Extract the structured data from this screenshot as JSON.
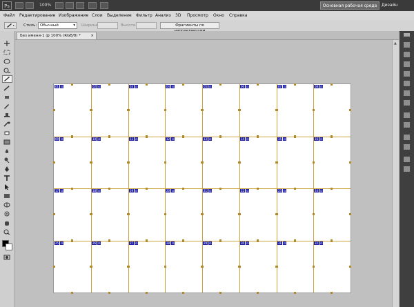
{
  "app": {
    "logo": "Ps",
    "zoom": "100%",
    "workspace": "Основная рабочая среда",
    "design": "Дизайн"
  },
  "menu": [
    "Файл",
    "Редактирование",
    "Изображение",
    "Слои",
    "Выделение",
    "Фильтр",
    "Анализ",
    "3D",
    "Просмотр",
    "Окно",
    "Справка"
  ],
  "options": {
    "style_label": "Стиль:",
    "style_value": "Обычный",
    "width_label": "Ширина:",
    "height_label": "Высота:",
    "guides_button": "Фрагменты по направляющим"
  },
  "document": {
    "tab_title": "Без имени-1 @ 100% (RGB/8) *",
    "close": "×"
  },
  "slices": {
    "rows": 4,
    "cols": 8,
    "ids": [
      "01",
      "02",
      "03",
      "04",
      "05",
      "06",
      "07",
      "08",
      "09",
      "10",
      "11",
      "12",
      "13",
      "14",
      "15",
      "16",
      "17",
      "18",
      "19",
      "20",
      "21",
      "22",
      "23",
      "24",
      "25",
      "26",
      "27",
      "28",
      "29",
      "30",
      "31",
      "32"
    ],
    "badge_text": "⊡"
  }
}
